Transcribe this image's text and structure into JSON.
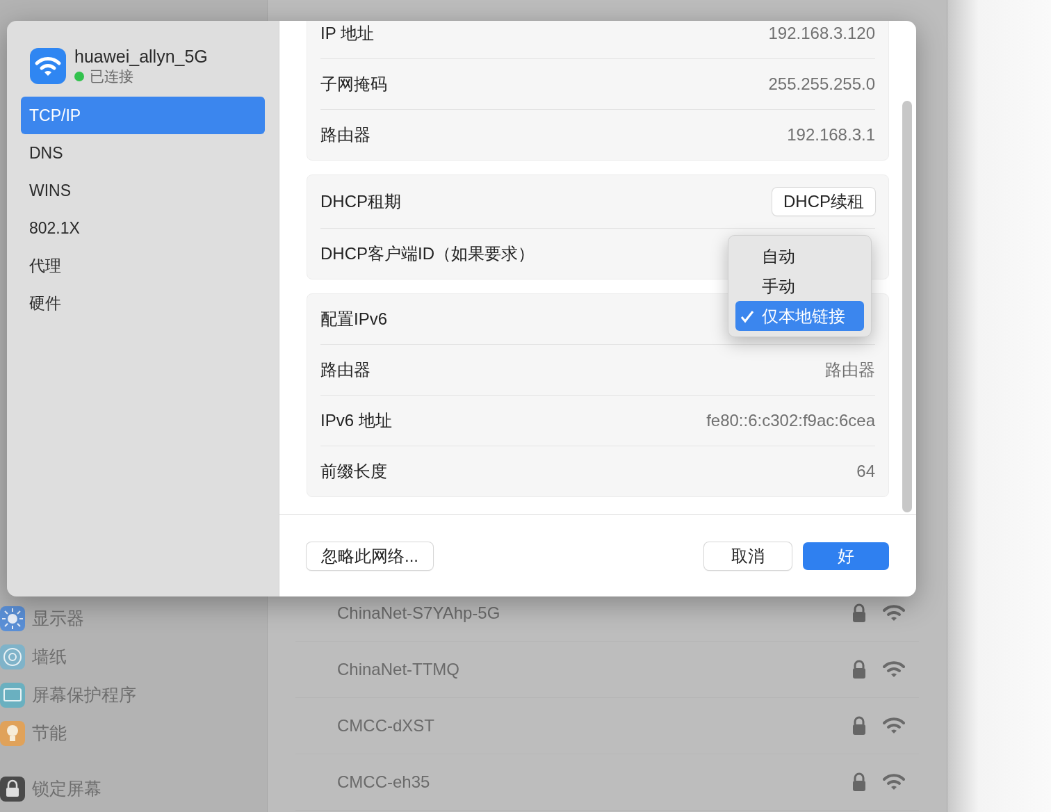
{
  "background": {
    "sidebar_items": [
      {
        "label": "显示器"
      },
      {
        "label": "墙纸"
      },
      {
        "label": "屏幕保护程序"
      },
      {
        "label": "节能"
      },
      {
        "label": "锁定屏幕"
      }
    ],
    "networks": [
      {
        "name": "ChinaNet-S7YAhp-5G",
        "secured": true
      },
      {
        "name": "ChinaNet-TTMQ",
        "secured": true
      },
      {
        "name": "CMCC-dXST",
        "secured": true
      },
      {
        "name": "CMCC-eh35",
        "secured": true
      }
    ]
  },
  "dialog": {
    "network": {
      "name": "huawei_allyn_5G",
      "status": "已连接",
      "connected": true
    },
    "sidebar": [
      {
        "label": "TCP/IP",
        "selected": true
      },
      {
        "label": "DNS",
        "selected": false
      },
      {
        "label": "WINS",
        "selected": false
      },
      {
        "label": "802.1X",
        "selected": false
      },
      {
        "label": "代理",
        "selected": false
      },
      {
        "label": "硬件",
        "selected": false
      }
    ],
    "groups": [
      {
        "rows": [
          {
            "kind": "text",
            "label": "IP 地址",
            "value": "192.168.3.120"
          },
          {
            "kind": "text",
            "label": "子网掩码",
            "value": "255.255.255.0"
          },
          {
            "kind": "text",
            "label": "路由器",
            "value": "192.168.3.1"
          }
        ]
      },
      {
        "rows": [
          {
            "kind": "button",
            "label": "DHCP租期",
            "value": "DHCP续租"
          },
          {
            "kind": "label",
            "label": "DHCP客户端ID（如果要求）"
          }
        ]
      },
      {
        "rows": [
          {
            "kind": "label",
            "label": "配置IPv6"
          },
          {
            "kind": "text",
            "label": "路由器",
            "value": "路由器"
          },
          {
            "kind": "text",
            "label": "IPv6 地址",
            "value": "fe80::6:c302:f9ac:6cea"
          },
          {
            "kind": "text",
            "label": "前缀长度",
            "value": "64"
          }
        ]
      }
    ],
    "menu": {
      "items": [
        {
          "label": "自动",
          "selected": false
        },
        {
          "label": "手动",
          "selected": false
        },
        {
          "label": "仅本地链接",
          "selected": true
        }
      ]
    },
    "footer": {
      "forget": "忽略此网络...",
      "cancel": "取消",
      "ok": "好"
    }
  }
}
